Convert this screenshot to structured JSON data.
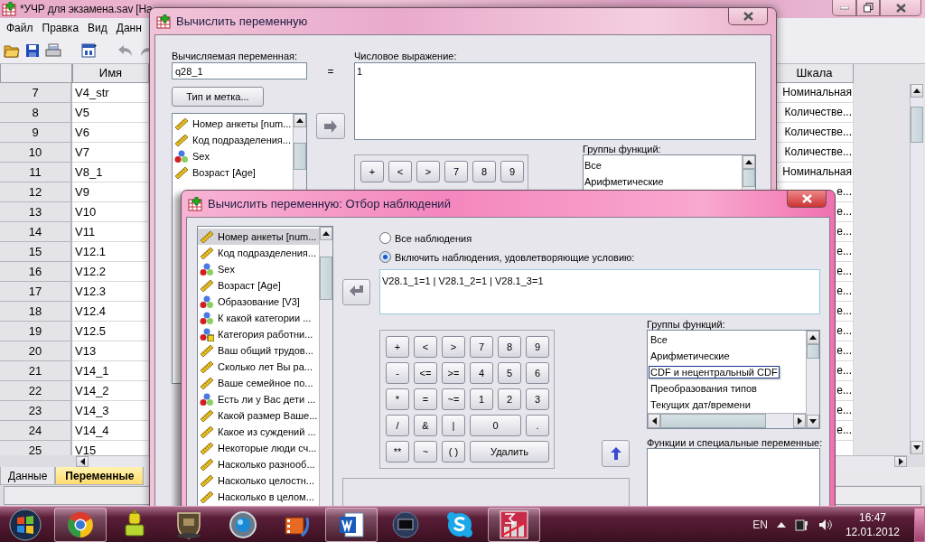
{
  "main_window": {
    "title": "*УЧР для экзамена.sav [На",
    "menu": [
      "Файл",
      "Правка",
      "Вид",
      "Данн"
    ],
    "table": {
      "columns": [
        "Имя",
        "Шкала"
      ],
      "rows": [
        {
          "number": "7",
          "name": "V4_str",
          "scale": "Номинальная"
        },
        {
          "number": "8",
          "name": "V5",
          "scale": "Количестве..."
        },
        {
          "number": "9",
          "name": "V6",
          "scale": "Количестве..."
        },
        {
          "number": "10",
          "name": "V7",
          "scale": "Количестве..."
        },
        {
          "number": "11",
          "name": "V8_1",
          "scale": "Номинальная"
        },
        {
          "number": "12",
          "name": "V9",
          "scale": "е..."
        },
        {
          "number": "13",
          "name": "V10",
          "scale": "е..."
        },
        {
          "number": "14",
          "name": "V11",
          "scale": "е..."
        },
        {
          "number": "15",
          "name": "V12.1",
          "scale": "е..."
        },
        {
          "number": "16",
          "name": "V12.2",
          "scale": "е..."
        },
        {
          "number": "17",
          "name": "V12.3",
          "scale": "е..."
        },
        {
          "number": "18",
          "name": "V12.4",
          "scale": "е..."
        },
        {
          "number": "19",
          "name": "V12.5",
          "scale": "е..."
        },
        {
          "number": "20",
          "name": "V13",
          "scale": "е..."
        },
        {
          "number": "21",
          "name": "V14_1",
          "scale": "е..."
        },
        {
          "number": "22",
          "name": "V14_2",
          "scale": "е..."
        },
        {
          "number": "23",
          "name": "V14_3",
          "scale": "е..."
        },
        {
          "number": "24",
          "name": "V14_4",
          "scale": "е..."
        },
        {
          "number": "25",
          "name": "V15"
        }
      ]
    },
    "tabs": [
      {
        "label": "Данные",
        "selected": false
      },
      {
        "label": "Переменные",
        "selected": true
      }
    ]
  },
  "compute_dialog": {
    "title": "Вычислить переменную",
    "target_label": "Вычисляемая переменная:",
    "target_value": "q28_1",
    "equals": "=",
    "expression_label": "Числовое выражение:",
    "expression": "1",
    "type_button": "Тип и метка...",
    "variables": [
      {
        "name": "Номер анкеты [num...",
        "kind": "scale"
      },
      {
        "name": "Код подразделения...",
        "kind": "scale"
      },
      {
        "name": "Sex",
        "kind": "nominal"
      },
      {
        "name": "Возраст [Age]",
        "kind": "scale"
      }
    ],
    "keypad": [
      "+",
      "<",
      ">",
      "7",
      "8",
      "9"
    ],
    "groups_label": "Группы функций:",
    "groups": [
      "Все",
      "Арифметические"
    ]
  },
  "select_dialog": {
    "title": "Вычислить переменную: Отбор наблюдений",
    "variables": [
      {
        "name": "Номер анкеты [num...",
        "kind": "scale",
        "selected": true
      },
      {
        "name": "Код подразделения...",
        "kind": "scale",
        "selected": false
      },
      {
        "name": "Sex",
        "kind": "nominal",
        "selected": false
      },
      {
        "name": "Возраст [Age]",
        "kind": "scale",
        "selected": false
      },
      {
        "name": "Образование [V3]",
        "kind": "nominal",
        "selected": false
      },
      {
        "name": "К какой категории ...",
        "kind": "nominal",
        "selected": false
      },
      {
        "name": "Категория работни...",
        "kind": "nominal-string",
        "selected": false
      },
      {
        "name": "Ваш общий трудов...",
        "kind": "scale",
        "selected": false
      },
      {
        "name": "Сколько лет Вы ра...",
        "kind": "scale",
        "selected": false
      },
      {
        "name": "Ваше семейное по...",
        "kind": "scale",
        "selected": false
      },
      {
        "name": "Есть ли у Вас дети ...",
        "kind": "nominal",
        "selected": false
      },
      {
        "name": "Какой размер Ваше...",
        "kind": "scale",
        "selected": false
      },
      {
        "name": "Какое из суждений ...",
        "kind": "scale",
        "selected": false
      },
      {
        "name": "Некоторые люди сч...",
        "kind": "scale",
        "selected": false
      },
      {
        "name": "Насколько разнооб...",
        "kind": "scale",
        "selected": false
      },
      {
        "name": "Насколько целостн...",
        "kind": "scale",
        "selected": false
      },
      {
        "name": "Насколько в целом...",
        "kind": "scale",
        "selected": false
      }
    ],
    "options": [
      {
        "label": "Все наблюдения",
        "selected": false
      },
      {
        "label": "Включить наблюдения, удовлетворяющие условию:",
        "selected": true
      }
    ],
    "condition": "V28.1_1=1 | V28.1_2=1 | V28.1_3=1",
    "keypad": [
      {
        "label": "+",
        "kind": "single"
      },
      {
        "label": "<",
        "kind": "single"
      },
      {
        "label": ">",
        "kind": "single"
      },
      {
        "label": "7",
        "kind": "single"
      },
      {
        "label": "8",
        "kind": "single"
      },
      {
        "label": "9",
        "kind": "single"
      },
      {
        "label": "-",
        "kind": "single"
      },
      {
        "label": "<=",
        "kind": "single"
      },
      {
        "label": ">=",
        "kind": "single"
      },
      {
        "label": "4",
        "kind": "single"
      },
      {
        "label": "5",
        "kind": "single"
      },
      {
        "label": "6",
        "kind": "single"
      },
      {
        "label": "*",
        "kind": "single"
      },
      {
        "label": "=",
        "kind": "single"
      },
      {
        "label": "~=",
        "kind": "single"
      },
      {
        "label": "1",
        "kind": "single"
      },
      {
        "label": "2",
        "kind": "single"
      },
      {
        "label": "3",
        "kind": "single"
      },
      {
        "label": "/",
        "kind": "single"
      },
      {
        "label": "&",
        "kind": "single"
      },
      {
        "label": "|",
        "kind": "single"
      },
      {
        "label": "0",
        "kind": "double"
      },
      {
        "label": ".",
        "kind": "single"
      },
      {
        "label": "**",
        "kind": "single"
      },
      {
        "label": "~",
        "kind": "single"
      },
      {
        "label": "( )",
        "kind": "single"
      },
      {
        "label": "Удалить",
        "kind": "triple"
      }
    ],
    "groups_label": "Группы функций:",
    "groups": [
      {
        "label": "Все",
        "focused": false
      },
      {
        "label": "Арифметические",
        "focused": false
      },
      {
        "label": "CDF и нецентральный CDF",
        "focused": true
      },
      {
        "label": "Преобразования типов",
        "focused": false
      },
      {
        "label": "Текущих дат/времени",
        "focused": false
      }
    ],
    "functions_label": "Функции и специальные переменные:"
  },
  "taskbar": {
    "apps": [
      {
        "running": true
      },
      {
        "running": false
      },
      {
        "running": false
      },
      {
        "running": false
      },
      {
        "running": false
      },
      {
        "running": true
      },
      {
        "running": false
      },
      {
        "running": false
      },
      {
        "running": true
      }
    ],
    "language": "EN",
    "time": "16:47",
    "date": "12.01.2012"
  }
}
